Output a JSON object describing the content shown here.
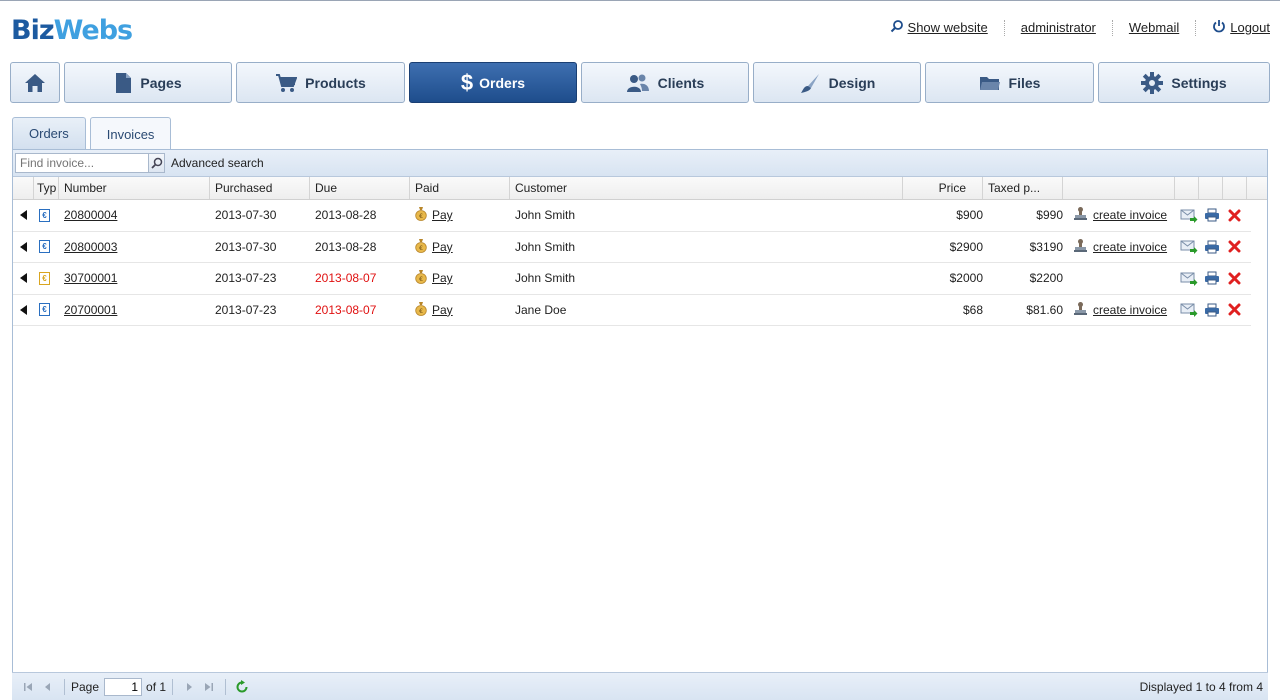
{
  "app": {
    "logo_part1": "Biz",
    "logo_part2": "Webs"
  },
  "toplinks": {
    "show_website": "Show website",
    "user": "administrator",
    "webmail": "Webmail",
    "logout": "Logout"
  },
  "nav": {
    "home_icon": "home-icon",
    "items": [
      {
        "label": "Pages",
        "icon": "page-icon"
      },
      {
        "label": "Products",
        "icon": "cart-icon"
      },
      {
        "label": "Orders",
        "icon": "dollar-icon"
      },
      {
        "label": "Clients",
        "icon": "users-icon"
      },
      {
        "label": "Design",
        "icon": "brush-icon"
      },
      {
        "label": "Files",
        "icon": "folder-icon"
      },
      {
        "label": "Settings",
        "icon": "gear-icon"
      }
    ],
    "active": "Orders"
  },
  "subtabs": [
    {
      "label": "Orders"
    },
    {
      "label": "Invoices"
    }
  ],
  "toolbar": {
    "search_placeholder": "Find invoice...",
    "advanced_search": "Advanced search"
  },
  "table": {
    "columns": [
      "Typ",
      "Number",
      "Purchased",
      "Due",
      "Paid",
      "Customer",
      "Price",
      "Taxed p..."
    ],
    "rows": [
      {
        "number": "20800004",
        "purchased": "2013-07-30",
        "due": "2013-08-28",
        "due_overdue": false,
        "paid": "Pay",
        "customer": "John Smith",
        "price": "$900",
        "taxed": "$990",
        "action": "create invoice",
        "type_color": "#2a6fc0"
      },
      {
        "number": "20800003",
        "purchased": "2013-07-30",
        "due": "2013-08-28",
        "due_overdue": false,
        "paid": "Pay",
        "customer": "John Smith",
        "price": "$2900",
        "taxed": "$3190",
        "action": "create invoice",
        "type_color": "#2a6fc0"
      },
      {
        "number": "30700001",
        "purchased": "2013-07-23",
        "due": "2013-08-07",
        "due_overdue": true,
        "paid": "Pay",
        "customer": "John Smith",
        "price": "$2000",
        "taxed": "$2200",
        "action": "",
        "type_color": "#d9a520"
      },
      {
        "number": "20700001",
        "purchased": "2013-07-23",
        "due": "2013-08-07",
        "due_overdue": true,
        "paid": "Pay",
        "customer": "Jane Doe",
        "price": "$68",
        "taxed": "$81.60",
        "action": "create invoice",
        "type_color": "#2a6fc0"
      }
    ]
  },
  "footer": {
    "page_label": "Page",
    "page_value": "1",
    "of_label": "of 1",
    "displayed": "Displayed 1 to 4 from 4"
  },
  "colors": {
    "accent": "#1e4d8c",
    "overdue": "#e01010",
    "delete": "#e02020"
  }
}
